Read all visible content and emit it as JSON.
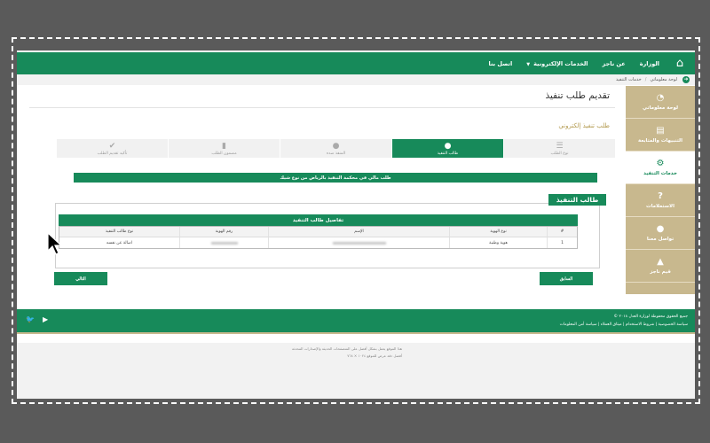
{
  "topnav": {
    "items": [
      {
        "label": "الوزارة"
      },
      {
        "label": "عن ناجز"
      },
      {
        "label": "الخدمات الإلكترونية",
        "dropdown": true
      },
      {
        "label": "اتصل بنا"
      }
    ]
  },
  "breadcrumb": [
    "لوحة معلوماتي",
    "خدمات التنفيذ"
  ],
  "sidebar": {
    "items": [
      {
        "label": "لوحة معلوماتي",
        "icon": "dashboard-icon",
        "glyph": "◔"
      },
      {
        "label": "التنبيهات والمتابعة",
        "icon": "document-icon",
        "glyph": "▤"
      },
      {
        "label": "خدمات التنفيذ",
        "icon": "gears-icon",
        "glyph": "⚙",
        "active": true
      },
      {
        "label": "الاستعلامات",
        "icon": "question-icon",
        "glyph": "?"
      },
      {
        "label": "تواصل معنا",
        "icon": "chat-icon",
        "glyph": "●"
      },
      {
        "label": "قيم ناجز",
        "icon": "thumbs-up-icon",
        "glyph": "▲"
      }
    ]
  },
  "page": {
    "title": "تقديم طلب تنفيذ",
    "subtitle": "طلب تنفيذ إلكتروني"
  },
  "steps": [
    {
      "label": "نوع الطلب",
      "icon": "list-icon",
      "glyph": "☰"
    },
    {
      "label": "طالب التنفيذ",
      "icon": "user-icon",
      "glyph": "●",
      "active": true
    },
    {
      "label": "المنفذ ضده",
      "icon": "user-icon",
      "glyph": "●"
    },
    {
      "label": "مضمون الطلب",
      "icon": "file-icon",
      "glyph": "▮"
    },
    {
      "label": "تأكيد تقديم الطلب",
      "icon": "check-icon",
      "glyph": "✔"
    }
  ],
  "banner": "طلب مالي في محكمة التنفيذ بالرياض من نوع شيك",
  "section": {
    "tab_label": "طالب التنفيذ",
    "details_title": "تفاصيل طالب التنفيذ"
  },
  "table": {
    "headers": [
      "#",
      "نوع الهوية",
      "الإسم",
      "رقم الهوية",
      "نوع طالب التنفيذ"
    ],
    "rows": [
      {
        "num": "1",
        "id_type": "هوية وطنية",
        "request_type": "اصالة عن نفسه"
      }
    ]
  },
  "buttons": {
    "prev": "السابق",
    "next": "التالي"
  },
  "footer": {
    "copyright": "جميع الحقوق محفوظة لوزارة العدل ٢٠١٨ ©",
    "links": "سياسة الخصوصية | شروط الاستخدام | ميثاق العملاء | سياسة أمن المعلومات"
  },
  "lower": {
    "line1": "هذا الموقع يعمل بشكل أفضل على المتصفحات الحديثة والإصدارات المحدثة",
    "line2": "أفضل دقة عرض للموقع ١٠٢٤ × ٧٦٨"
  },
  "colors": {
    "primary": "#178a5a",
    "sidebar": "#c8b88e",
    "accent_text": "#b39a4f"
  }
}
